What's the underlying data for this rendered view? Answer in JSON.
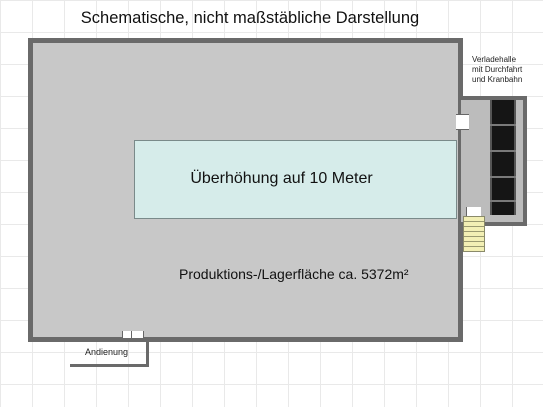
{
  "title": "Schematische, nicht maßstäbliche Darstellung",
  "main_hall": {
    "elevated_area_label": "Überhöhung auf 10 Meter",
    "area_label": "Produktions-/Lagerfläche ca. 5372m²"
  },
  "loading_hall": {
    "label": "Verladehalle\nmit Durchfahrt\nund Kranbahn"
  },
  "delivery_label": "Andienung",
  "colors": {
    "wall": "#6a6a6a",
    "floor": "#c8c8c8",
    "elevated_area": "#d6ecea",
    "crane_track": "#151515",
    "stairs": "#f2efb4"
  }
}
